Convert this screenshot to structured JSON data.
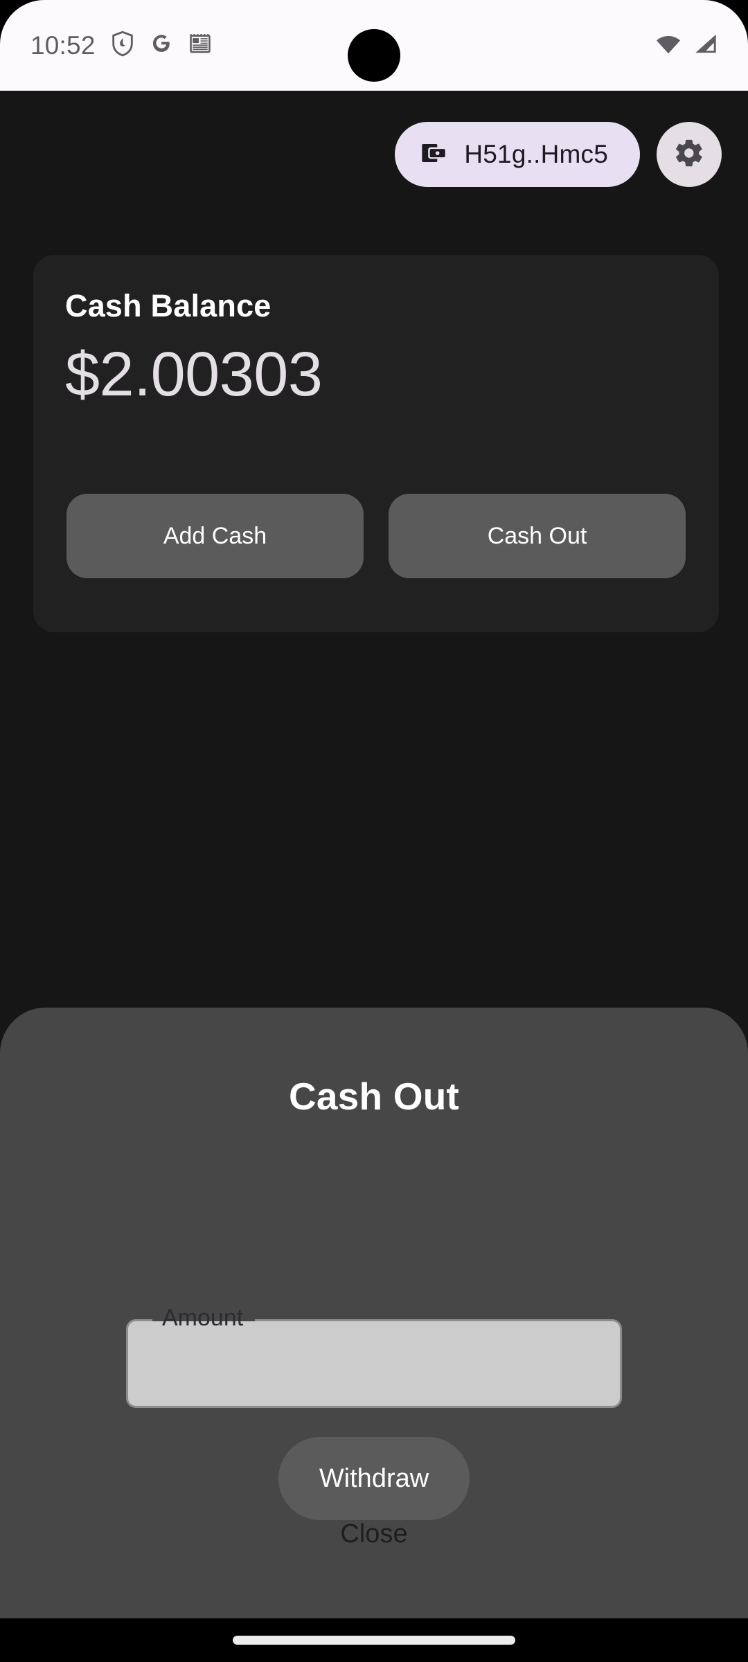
{
  "status_bar": {
    "time": "10:52",
    "icons_left": [
      "shield-icon",
      "google-g-icon",
      "notes-icon"
    ],
    "icons_right": [
      "wifi-icon",
      "cellular-signal-icon"
    ],
    "background_color": "#FDFAFD",
    "icon_color": "#5f5d61"
  },
  "top_bar": {
    "wallet_chip": {
      "icon": "wallet-icon",
      "address": "H51g..Hmc5",
      "background_color": "#E9DFF2",
      "text_color": "#1d1a22"
    },
    "settings_button": {
      "icon": "gear-icon",
      "background_color": "#E5DEE5"
    }
  },
  "balance_card": {
    "title": "Cash Balance",
    "amount": "$2.00303",
    "background_color": "#212121",
    "amount_color": "#E4DFE5",
    "actions": [
      {
        "label": "Add Cash",
        "name": "add-cash-button"
      },
      {
        "label": "Cash Out",
        "name": "cash-out-button"
      }
    ]
  },
  "bottom_sheet": {
    "title": "Cash Out",
    "background_color": "#474747",
    "amount_field": {
      "label": "Amount",
      "value": "",
      "placeholder": "",
      "background_color": "#CCCCCC"
    },
    "withdraw_label": "Withdraw",
    "close_label": "Close"
  },
  "app": {
    "background_color": "#161616"
  },
  "nav_bar": {
    "handle": "gesture-home-handle"
  }
}
